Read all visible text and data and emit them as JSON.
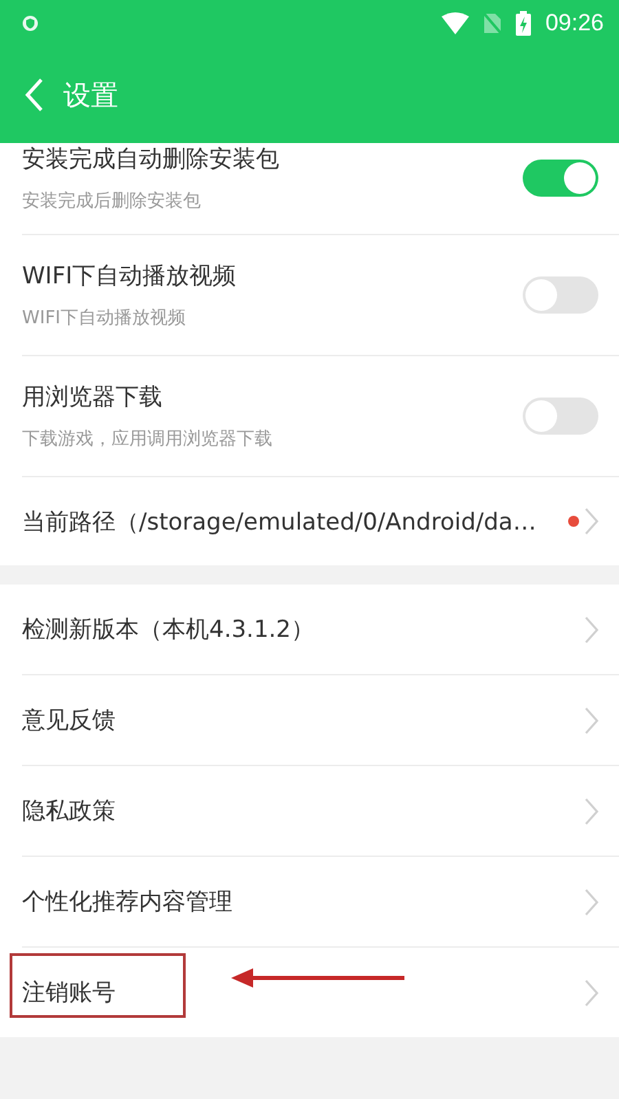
{
  "status_bar": {
    "time": "09:26"
  },
  "header": {
    "title": "设置"
  },
  "sections": [
    {
      "items": [
        {
          "kind": "toggle",
          "title": "安装完成自动删除安装包",
          "subtitle": "安装完成后删除安装包",
          "on": true
        },
        {
          "kind": "toggle",
          "title": "WIFI下自动播放视频",
          "subtitle": "WIFI下自动播放视频",
          "on": false
        },
        {
          "kind": "toggle",
          "title": "用浏览器下载",
          "subtitle": "下载游戏，应用调用浏览器下载",
          "on": false
        },
        {
          "kind": "link",
          "title": "当前路径（/storage/emulated/0/Android/da…",
          "dot": true,
          "highlighted": false
        }
      ]
    },
    {
      "items": [
        {
          "kind": "link",
          "title": "检测新版本（本机4.3.1.2）",
          "dot": false,
          "highlighted": false
        },
        {
          "kind": "link",
          "title": "意见反馈",
          "dot": false,
          "highlighted": false
        },
        {
          "kind": "link",
          "title": "隐私政策",
          "dot": false,
          "highlighted": false
        },
        {
          "kind": "link",
          "title": "个性化推荐内容管理",
          "dot": false,
          "highlighted": false
        },
        {
          "kind": "link",
          "title": "注销账号",
          "dot": false,
          "highlighted": true
        }
      ]
    }
  ]
}
